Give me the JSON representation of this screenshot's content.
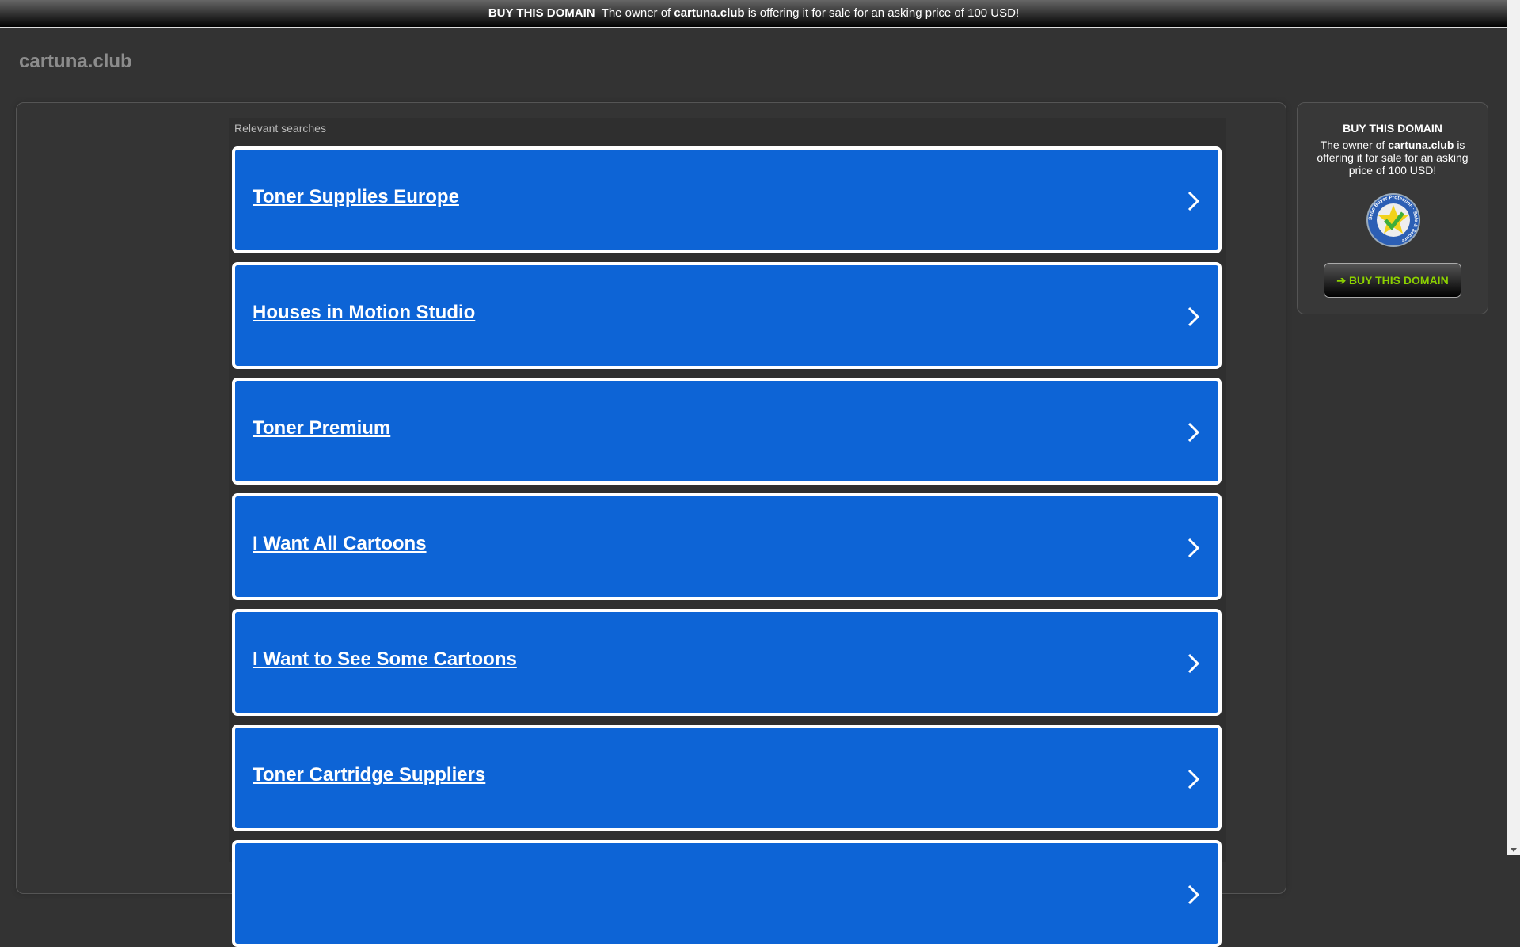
{
  "topbar": {
    "lead": "BUY THIS DOMAIN",
    "text1": "The owner of",
    "domain": "cartuna.club",
    "text2": "is offering it for sale for an asking price of 100 USD!"
  },
  "site_title": "cartuna.club",
  "searches": {
    "label": "Relevant searches",
    "items": [
      {
        "label": "Toner Supplies Europe"
      },
      {
        "label": "Houses in Motion Studio"
      },
      {
        "label": "Toner Premium"
      },
      {
        "label": "I Want All Cartoons"
      },
      {
        "label": "I Want to See Some Cartoons"
      },
      {
        "label": "Toner Cartridge Suppliers"
      },
      {
        "label": ""
      }
    ]
  },
  "sidebar": {
    "heading": "BUY THIS DOMAIN",
    "text1": "The owner of",
    "domain": "cartuna.club",
    "text2": "is offering it for sale for an asking price of 100 USD!",
    "badge_text": "Sedo Buyer Protection · Safe & Secure",
    "button_label": "BUY THIS DOMAIN"
  },
  "colors": {
    "card": "#0d64d6",
    "button_text": "#8cd100"
  }
}
